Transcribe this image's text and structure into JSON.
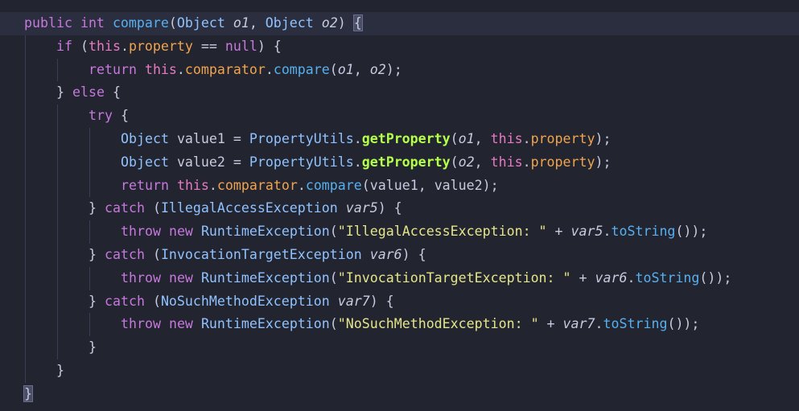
{
  "lines": [
    {
      "indent": 0,
      "current": true,
      "tokens": [
        {
          "t": "public",
          "c": "kw"
        },
        {
          "t": " ",
          "c": "plain"
        },
        {
          "t": "int",
          "c": "kw"
        },
        {
          "t": " ",
          "c": "plain"
        },
        {
          "t": "compare",
          "c": "fn"
        },
        {
          "t": "(",
          "c": "bracket"
        },
        {
          "t": "Object",
          "c": "type"
        },
        {
          "t": " ",
          "c": "plain"
        },
        {
          "t": "o1",
          "c": "param"
        },
        {
          "t": ", ",
          "c": "plain"
        },
        {
          "t": "Object",
          "c": "type"
        },
        {
          "t": " ",
          "c": "plain"
        },
        {
          "t": "o2",
          "c": "param"
        },
        {
          "t": ") ",
          "c": "bracket"
        },
        {
          "t": "{",
          "c": "brace-hl"
        }
      ]
    },
    {
      "indent": 1,
      "tokens": [
        {
          "t": "if",
          "c": "kw"
        },
        {
          "t": " (",
          "c": "bracket"
        },
        {
          "t": "this",
          "c": "this"
        },
        {
          "t": ".",
          "c": "plain"
        },
        {
          "t": "property",
          "c": "field"
        },
        {
          "t": " == ",
          "c": "op"
        },
        {
          "t": "null",
          "c": "kw"
        },
        {
          "t": ") {",
          "c": "bracket"
        }
      ]
    },
    {
      "indent": 2,
      "tokens": [
        {
          "t": "return",
          "c": "kw"
        },
        {
          "t": " ",
          "c": "plain"
        },
        {
          "t": "this",
          "c": "this"
        },
        {
          "t": ".",
          "c": "plain"
        },
        {
          "t": "comparator",
          "c": "field"
        },
        {
          "t": ".",
          "c": "plain"
        },
        {
          "t": "compare",
          "c": "fn"
        },
        {
          "t": "(",
          "c": "bracket"
        },
        {
          "t": "o1",
          "c": "param"
        },
        {
          "t": ", ",
          "c": "plain"
        },
        {
          "t": "o2",
          "c": "param"
        },
        {
          "t": ");",
          "c": "bracket"
        }
      ]
    },
    {
      "indent": 1,
      "tokens": [
        {
          "t": "}",
          "c": "bracket"
        },
        {
          "t": " ",
          "c": "plain"
        },
        {
          "t": "else",
          "c": "kw"
        },
        {
          "t": " {",
          "c": "bracket"
        }
      ]
    },
    {
      "indent": 2,
      "tokens": [
        {
          "t": "try",
          "c": "kw"
        },
        {
          "t": " {",
          "c": "bracket"
        }
      ]
    },
    {
      "indent": 3,
      "tokens": [
        {
          "t": "Object",
          "c": "type"
        },
        {
          "t": " value1 = ",
          "c": "plain"
        },
        {
          "t": "PropertyUtils",
          "c": "type"
        },
        {
          "t": ".",
          "c": "plain"
        },
        {
          "t": "getProperty",
          "c": "static"
        },
        {
          "t": "(",
          "c": "bracket"
        },
        {
          "t": "o1",
          "c": "param"
        },
        {
          "t": ", ",
          "c": "plain"
        },
        {
          "t": "this",
          "c": "this"
        },
        {
          "t": ".",
          "c": "plain"
        },
        {
          "t": "property",
          "c": "field"
        },
        {
          "t": ");",
          "c": "bracket"
        }
      ]
    },
    {
      "indent": 3,
      "tokens": [
        {
          "t": "Object",
          "c": "type"
        },
        {
          "t": " value2 = ",
          "c": "plain"
        },
        {
          "t": "PropertyUtils",
          "c": "type"
        },
        {
          "t": ".",
          "c": "plain"
        },
        {
          "t": "getProperty",
          "c": "static"
        },
        {
          "t": "(",
          "c": "bracket"
        },
        {
          "t": "o2",
          "c": "param"
        },
        {
          "t": ", ",
          "c": "plain"
        },
        {
          "t": "this",
          "c": "this"
        },
        {
          "t": ".",
          "c": "plain"
        },
        {
          "t": "property",
          "c": "field"
        },
        {
          "t": ");",
          "c": "bracket"
        }
      ]
    },
    {
      "indent": 3,
      "tokens": [
        {
          "t": "return",
          "c": "kw"
        },
        {
          "t": " ",
          "c": "plain"
        },
        {
          "t": "this",
          "c": "this"
        },
        {
          "t": ".",
          "c": "plain"
        },
        {
          "t": "comparator",
          "c": "field"
        },
        {
          "t": ".",
          "c": "plain"
        },
        {
          "t": "compare",
          "c": "fn"
        },
        {
          "t": "(",
          "c": "bracket"
        },
        {
          "t": "value1, value2",
          "c": "plain"
        },
        {
          "t": ");",
          "c": "bracket"
        }
      ]
    },
    {
      "indent": 2,
      "tokens": [
        {
          "t": "}",
          "c": "bracket"
        },
        {
          "t": " ",
          "c": "plain"
        },
        {
          "t": "catch",
          "c": "kw"
        },
        {
          "t": " (",
          "c": "bracket"
        },
        {
          "t": "IllegalAccessException",
          "c": "type"
        },
        {
          "t": " ",
          "c": "plain"
        },
        {
          "t": "var5",
          "c": "param"
        },
        {
          "t": ") {",
          "c": "bracket"
        }
      ]
    },
    {
      "indent": 3,
      "tokens": [
        {
          "t": "throw",
          "c": "kw"
        },
        {
          "t": " ",
          "c": "plain"
        },
        {
          "t": "new",
          "c": "kw"
        },
        {
          "t": " ",
          "c": "plain"
        },
        {
          "t": "RuntimeException",
          "c": "type"
        },
        {
          "t": "(",
          "c": "bracket"
        },
        {
          "t": "\"IllegalAccessException: \"",
          "c": "string"
        },
        {
          "t": " + ",
          "c": "op"
        },
        {
          "t": "var5",
          "c": "param"
        },
        {
          "t": ".",
          "c": "plain"
        },
        {
          "t": "toString",
          "c": "fn"
        },
        {
          "t": "());",
          "c": "bracket"
        }
      ]
    },
    {
      "indent": 2,
      "tokens": [
        {
          "t": "}",
          "c": "bracket"
        },
        {
          "t": " ",
          "c": "plain"
        },
        {
          "t": "catch",
          "c": "kw"
        },
        {
          "t": " (",
          "c": "bracket"
        },
        {
          "t": "InvocationTargetException",
          "c": "type"
        },
        {
          "t": " ",
          "c": "plain"
        },
        {
          "t": "var6",
          "c": "param"
        },
        {
          "t": ") {",
          "c": "bracket"
        }
      ]
    },
    {
      "indent": 3,
      "tokens": [
        {
          "t": "throw",
          "c": "kw"
        },
        {
          "t": " ",
          "c": "plain"
        },
        {
          "t": "new",
          "c": "kw"
        },
        {
          "t": " ",
          "c": "plain"
        },
        {
          "t": "RuntimeException",
          "c": "type"
        },
        {
          "t": "(",
          "c": "bracket"
        },
        {
          "t": "\"InvocationTargetException: \"",
          "c": "string"
        },
        {
          "t": " + ",
          "c": "op"
        },
        {
          "t": "var6",
          "c": "param"
        },
        {
          "t": ".",
          "c": "plain"
        },
        {
          "t": "toString",
          "c": "fn"
        },
        {
          "t": "());",
          "c": "bracket"
        }
      ]
    },
    {
      "indent": 2,
      "tokens": [
        {
          "t": "}",
          "c": "bracket"
        },
        {
          "t": " ",
          "c": "plain"
        },
        {
          "t": "catch",
          "c": "kw"
        },
        {
          "t": " (",
          "c": "bracket"
        },
        {
          "t": "NoSuchMethodException",
          "c": "type"
        },
        {
          "t": " ",
          "c": "plain"
        },
        {
          "t": "var7",
          "c": "param"
        },
        {
          "t": ") {",
          "c": "bracket"
        }
      ]
    },
    {
      "indent": 3,
      "tokens": [
        {
          "t": "throw",
          "c": "kw"
        },
        {
          "t": " ",
          "c": "plain"
        },
        {
          "t": "new",
          "c": "kw"
        },
        {
          "t": " ",
          "c": "plain"
        },
        {
          "t": "RuntimeException",
          "c": "type"
        },
        {
          "t": "(",
          "c": "bracket"
        },
        {
          "t": "\"NoSuchMethodException: \"",
          "c": "string"
        },
        {
          "t": " + ",
          "c": "op"
        },
        {
          "t": "var7",
          "c": "param"
        },
        {
          "t": ".",
          "c": "plain"
        },
        {
          "t": "toString",
          "c": "fn"
        },
        {
          "t": "());",
          "c": "bracket"
        }
      ]
    },
    {
      "indent": 2,
      "tokens": [
        {
          "t": "}",
          "c": "bracket"
        }
      ]
    },
    {
      "indent": 1,
      "tokens": [
        {
          "t": "}",
          "c": "bracket"
        }
      ]
    },
    {
      "indent": 0,
      "tokens": [
        {
          "t": "}",
          "c": "brace-hl"
        }
      ]
    }
  ]
}
